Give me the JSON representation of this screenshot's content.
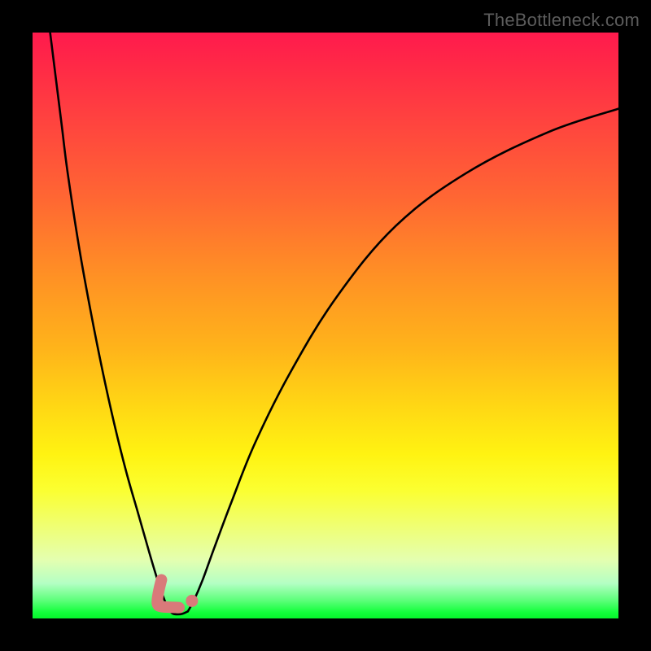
{
  "watermark": "TheBottleneck.com",
  "colors": {
    "frame": "#000000",
    "curve": "#000000",
    "marker_fill": "#d97a7a",
    "gradient_top": "#ff1a4d",
    "gradient_mid": "#ffd814",
    "gradient_bottom": "#12ff3a"
  },
  "chart_data": {
    "type": "line",
    "title": "",
    "xlabel": "",
    "ylabel": "",
    "xlim": [
      0,
      100
    ],
    "ylim": [
      0,
      100
    ],
    "grid": false,
    "legend": false,
    "series": [
      {
        "name": "left-curve",
        "x": [
          3,
          4,
          5,
          6,
          8,
          10,
          12,
          14,
          16,
          18,
          20,
          21.2,
          22.2,
          23.0,
          23.5
        ],
        "values": [
          100,
          92,
          84,
          76,
          63,
          52,
          42,
          33,
          25,
          18,
          11,
          7.0,
          4.0,
          2.0,
          1.2
        ]
      },
      {
        "name": "right-curve",
        "x": [
          26.5,
          27.5,
          29,
          31,
          34,
          38,
          44,
          52,
          62,
          74,
          88,
          100
        ],
        "values": [
          1.2,
          3.0,
          6.5,
          12,
          20,
          30,
          42,
          55,
          67,
          76,
          83,
          87
        ]
      },
      {
        "name": "valley-floor",
        "x": [
          23.5,
          24.0,
          24.8,
          25.6,
          26.5
        ],
        "values": [
          1.2,
          0.8,
          0.7,
          0.8,
          1.2
        ]
      }
    ],
    "markers": [
      {
        "name": "L-marker-stroke",
        "type": "path",
        "path_xy": [
          [
            22.0,
            6.6
          ],
          [
            21.7,
            5.4
          ],
          [
            21.45,
            4.2
          ],
          [
            21.3,
            3.1
          ],
          [
            21.35,
            2.4
          ],
          [
            21.8,
            2.05
          ],
          [
            22.8,
            1.95
          ],
          [
            24.1,
            1.9
          ],
          [
            25.0,
            1.85
          ]
        ]
      },
      {
        "name": "dot-marker",
        "type": "dot",
        "x": 27.2,
        "y": 3.0
      }
    ]
  }
}
